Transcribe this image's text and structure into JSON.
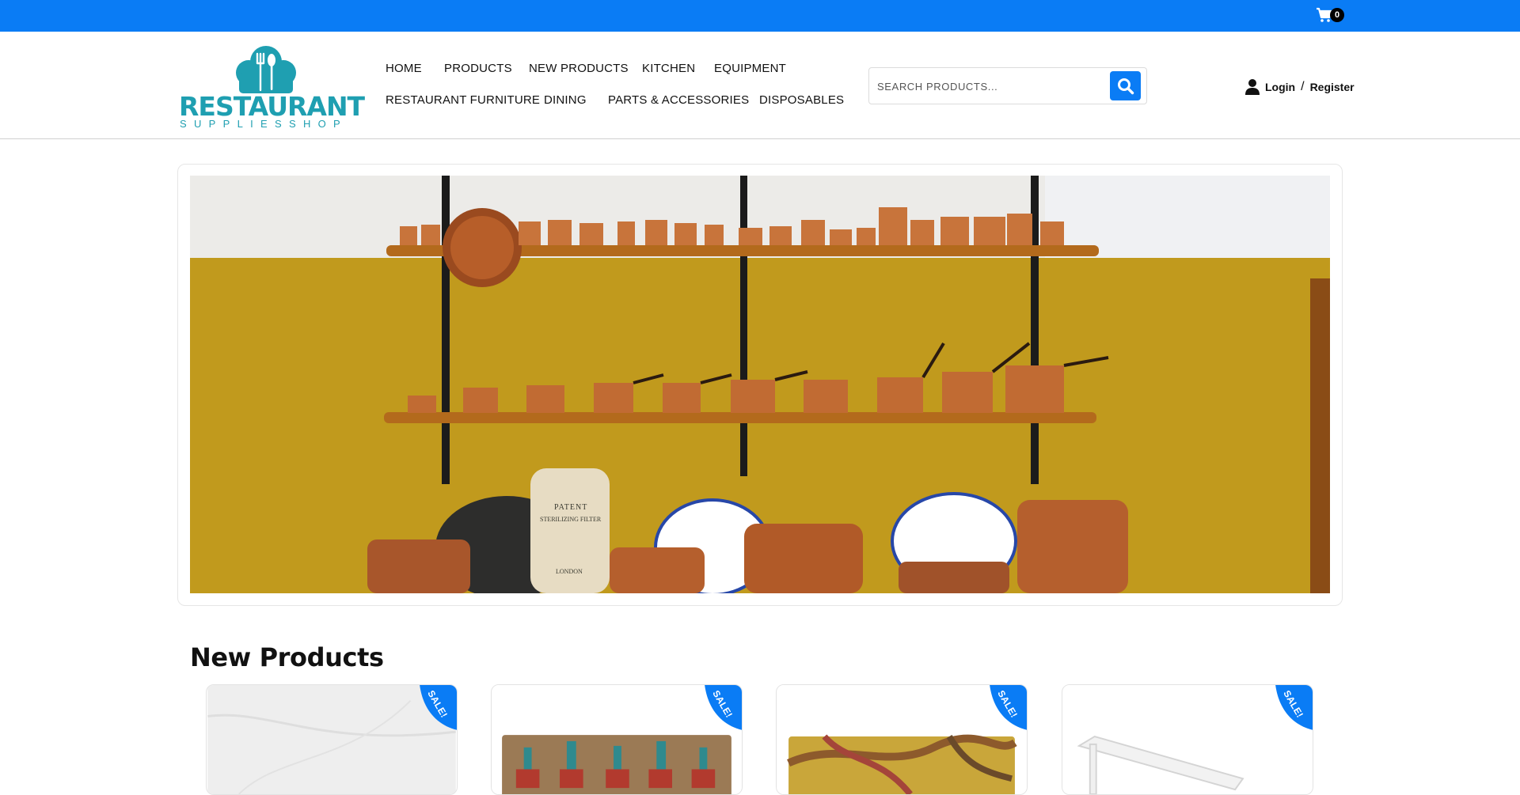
{
  "topbar": {
    "cart_count": "0"
  },
  "logo": {
    "word": "RESTAURANT",
    "sub": "SUPPLIESSHOP"
  },
  "nav": {
    "row1": [
      "HOME",
      "PRODUCTS",
      "NEW PRODUCTS",
      "KITCHEN",
      "EQUIPMENT"
    ],
    "row2": [
      "RESTAURANT FURNITURE",
      "DINING",
      "PARTS & ACCESSORIES",
      "DISPOSABLES"
    ]
  },
  "search": {
    "placeholder": "SEARCH PRODUCTS..."
  },
  "account": {
    "login": "Login",
    "separator": "/",
    "register": "Register"
  },
  "hero": {
    "image": "copper-cookware-shelves-photo",
    "jar_text": [
      "PATENT",
      "STERILIZING FILTER",
      "LONDON"
    ]
  },
  "section": {
    "title": "New Products"
  },
  "products": [
    {
      "badge": "SALE!",
      "image": "marble-backdrop-product"
    },
    {
      "badge": "SALE!",
      "image": "cactus-pots-doormat"
    },
    {
      "badge": "SALE!",
      "image": "wavy-pattern-doormat"
    },
    {
      "badge": "SALE!",
      "image": "white-rack-product"
    }
  ],
  "colors": {
    "accent": "#0a7cf5",
    "logo": "#1f9fb1"
  }
}
